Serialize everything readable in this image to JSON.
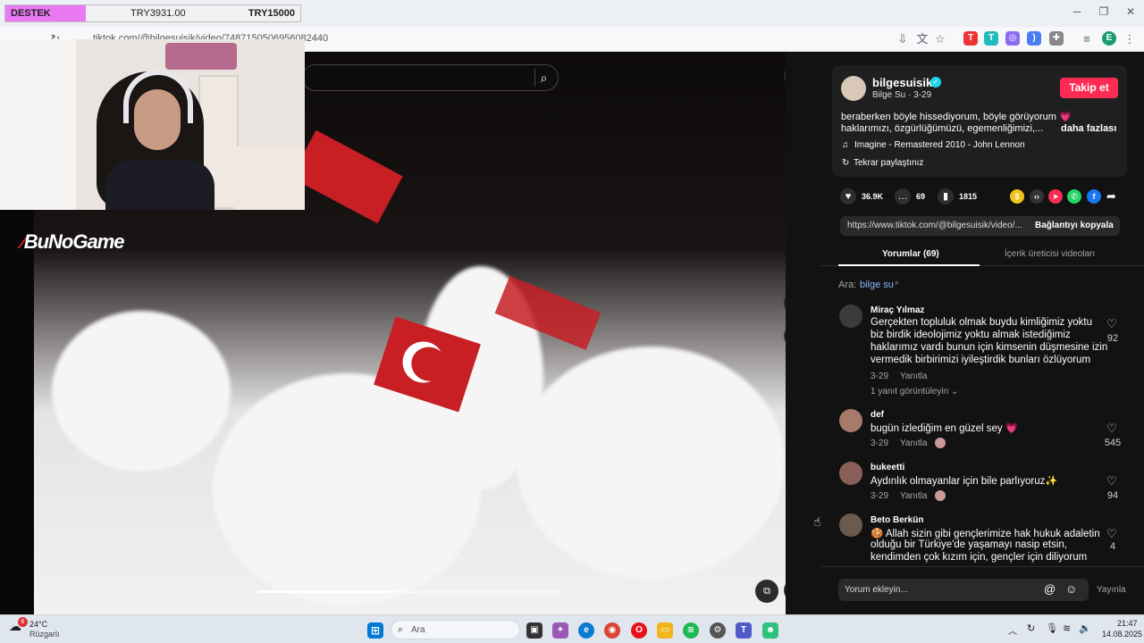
{
  "donation": {
    "label": "DESTEK",
    "current": "TRY3931.00",
    "goal": "TRY15000"
  },
  "browser": {
    "url": "tiktok.com/@bilgesuisik/video/7487150506956082440"
  },
  "overlay": {
    "logo": "BuNoGame"
  },
  "video": {
    "progress": 0.45
  },
  "post": {
    "username": "bilgesuisik",
    "display_line": "Bilge Su · 3-29",
    "follow_label": "Takip et",
    "caption_1": "beraberken böyle hissediyorum, böyle görüyorum 💗",
    "caption_2": "haklarımızı, özgürlüğümüzü, egemenliğimizi,...",
    "more_label": "daha fazlası",
    "music": "Imagine - Remastered 2010 - John Lennon",
    "reposted": "Tekrar paylaştınız",
    "likes": "36.9K",
    "comments": "69",
    "saves": "1815",
    "link": "https://www.tiktok.com/@bilgesuisik/video/...",
    "copy_link_label": "Bağlantıyı kopyala"
  },
  "tabs": {
    "comments": "Yorumlar (69)",
    "creator_videos": "İçerik üreticisi videoları"
  },
  "search_hint": {
    "prefix": "Ara:",
    "query": "bilge su"
  },
  "comments": [
    {
      "user": "Miraç Yılmaz",
      "lines": [
        "Gerçekten topluluk olmak buydu kimliğimiz yoktu",
        "biz birdik ideolojimiz yoktu almak istediğimiz",
        "haklarımız vardı bunun için kimsenin düşmesine izin",
        "vermedik birbirimizi iyileştirdik bunları özlüyorum"
      ],
      "date": "3-29",
      "reply": "Yanıtla",
      "likes": "92",
      "view_replies": "1 yanıt görüntüleyin"
    },
    {
      "user": "def",
      "lines": [
        "bugün izlediğim en güzel sey 💗"
      ],
      "date": "3-29",
      "reply": "Yanıtla",
      "likes": "545"
    },
    {
      "user": "bukeetti",
      "lines": [
        "Aydınlık olmayanlar için bile parlıyoruz✨"
      ],
      "date": "3-29",
      "reply": "Yanıtla",
      "likes": "94"
    },
    {
      "user": "Beto Berkün",
      "lines": [
        "🍪 Allah sizin gibi gençlerimize hak hukuk adaletin",
        "olduğu bir Türkiye'de yaşamayı nasip etsin,",
        "kendimden çok kızım için, gençler için diliyorum"
      ],
      "likes": "4"
    }
  ],
  "comment_input": {
    "placeholder": "Yorum ekleyin...",
    "post_label": "Yayınla"
  },
  "taskbar": {
    "weather_temp": "24°C",
    "weather_desc": "Rüzgarlı",
    "weather_badge": "6",
    "search_label": "Ara",
    "time": "21:47",
    "date": "14.08.2025"
  },
  "colors": {
    "tiktok_red": "#fe2c55",
    "panel_bg": "#121212",
    "donate_pink": "#ea7af3"
  }
}
